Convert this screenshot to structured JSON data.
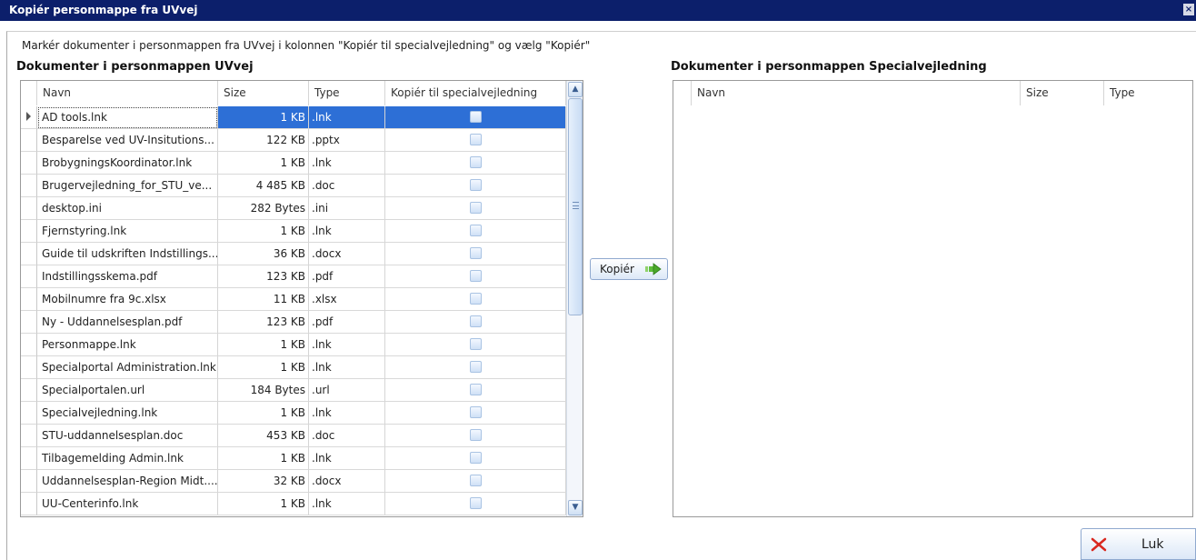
{
  "window": {
    "title": "Kopiér personmappe fra UVvej",
    "close_glyph": "×"
  },
  "instructions": "Markér dokumenter i personmappen fra UVvej i kolonnen \"Kopiér til specialvejledning\" og vælg \"Kopiér\"",
  "left_panel": {
    "heading": "Dokumenter i personmappen UVvej",
    "columns": [
      "Navn",
      "Size",
      "Type",
      "Kopiér til specialvejledning"
    ],
    "selected_row": 0,
    "rows": [
      {
        "name": "AD tools.lnk",
        "size": "1 KB",
        "type": ".lnk",
        "checked": false
      },
      {
        "name": "Besparelse ved UV-Insitutions...",
        "size": "122 KB",
        "type": ".pptx",
        "checked": false
      },
      {
        "name": "BrobygningsKoordinator.lnk",
        "size": "1 KB",
        "type": ".lnk",
        "checked": false
      },
      {
        "name": "Brugervejledning_for_STU_ve...",
        "size": "4 485 KB",
        "type": ".doc",
        "checked": false
      },
      {
        "name": "desktop.ini",
        "size": "282 Bytes",
        "type": ".ini",
        "checked": false
      },
      {
        "name": "Fjernstyring.lnk",
        "size": "1 KB",
        "type": ".lnk",
        "checked": false
      },
      {
        "name": "Guide til udskriften Indstillings...",
        "size": "36 KB",
        "type": ".docx",
        "checked": false
      },
      {
        "name": "Indstillingsskema.pdf",
        "size": "123 KB",
        "type": ".pdf",
        "checked": false
      },
      {
        "name": "Mobilnumre fra 9c.xlsx",
        "size": "11 KB",
        "type": ".xlsx",
        "checked": false
      },
      {
        "name": "Ny - Uddannelsesplan.pdf",
        "size": "123 KB",
        "type": ".pdf",
        "checked": false
      },
      {
        "name": "Personmappe.lnk",
        "size": "1 KB",
        "type": ".lnk",
        "checked": false
      },
      {
        "name": "Specialportal Administration.lnk",
        "size": "1 KB",
        "type": ".lnk",
        "checked": false
      },
      {
        "name": "Specialportalen.url",
        "size": "184 Bytes",
        "type": ".url",
        "checked": false
      },
      {
        "name": "Specialvejledning.lnk",
        "size": "1 KB",
        "type": ".lnk",
        "checked": false
      },
      {
        "name": "STU-uddannelsesplan.doc",
        "size": "453 KB",
        "type": ".doc",
        "checked": false
      },
      {
        "name": "Tilbagemelding Admin.lnk",
        "size": "1 KB",
        "type": ".lnk",
        "checked": false
      },
      {
        "name": "Uddannelsesplan-Region Midt....",
        "size": "32 KB",
        "type": ".docx",
        "checked": false
      },
      {
        "name": "UU-Centerinfo.lnk",
        "size": "1 KB",
        "type": ".lnk",
        "checked": false
      }
    ]
  },
  "right_panel": {
    "heading": "Dokumenter i personmappen Specialvejledning",
    "columns": [
      "Navn",
      "Size",
      "Type"
    ]
  },
  "buttons": {
    "copy_label": "Kopiér",
    "close_label": "Luk"
  },
  "colors": {
    "titlebar": "#0c1f6b",
    "selection": "#2d6fd6",
    "copy_arrow": "#5fbf3a",
    "close_x": "#d9281f"
  },
  "icons": {
    "copy": "green-arrow-right-icon",
    "close": "red-x-icon",
    "row_pointer": "triangle-right-icon"
  }
}
